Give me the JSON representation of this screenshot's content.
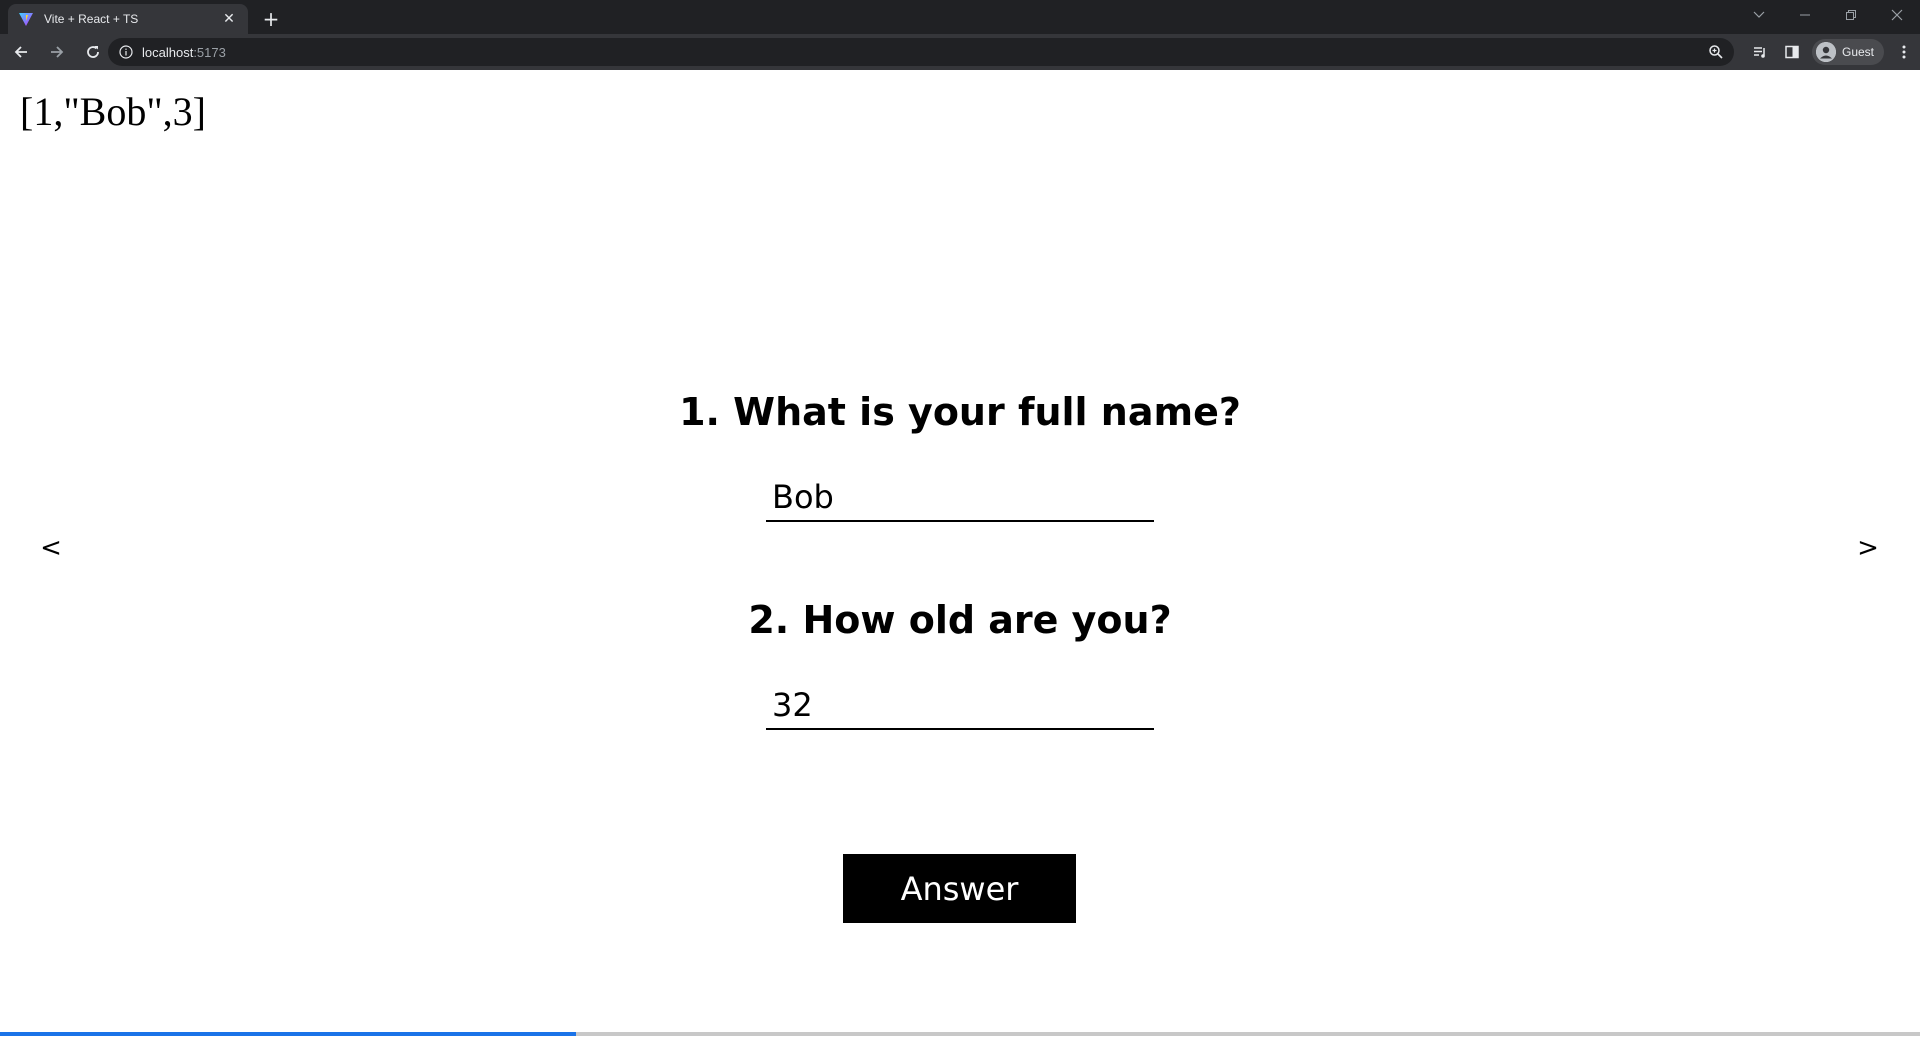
{
  "browser": {
    "tab_title": "Vite + React + TS",
    "url_host": "localhost",
    "url_port": ":5173",
    "profile_label": "Guest"
  },
  "page": {
    "debug_output": "[1,\"Bob\",3]",
    "prev_label": "<",
    "next_label": ">",
    "questions": [
      {
        "label": "1. What is your full name?",
        "value": "Bob"
      },
      {
        "label": "2. How old are you?",
        "value": "32"
      }
    ],
    "submit_label": "Answer",
    "progress_fraction": 0.3,
    "progress_color": "#1a73e8"
  }
}
